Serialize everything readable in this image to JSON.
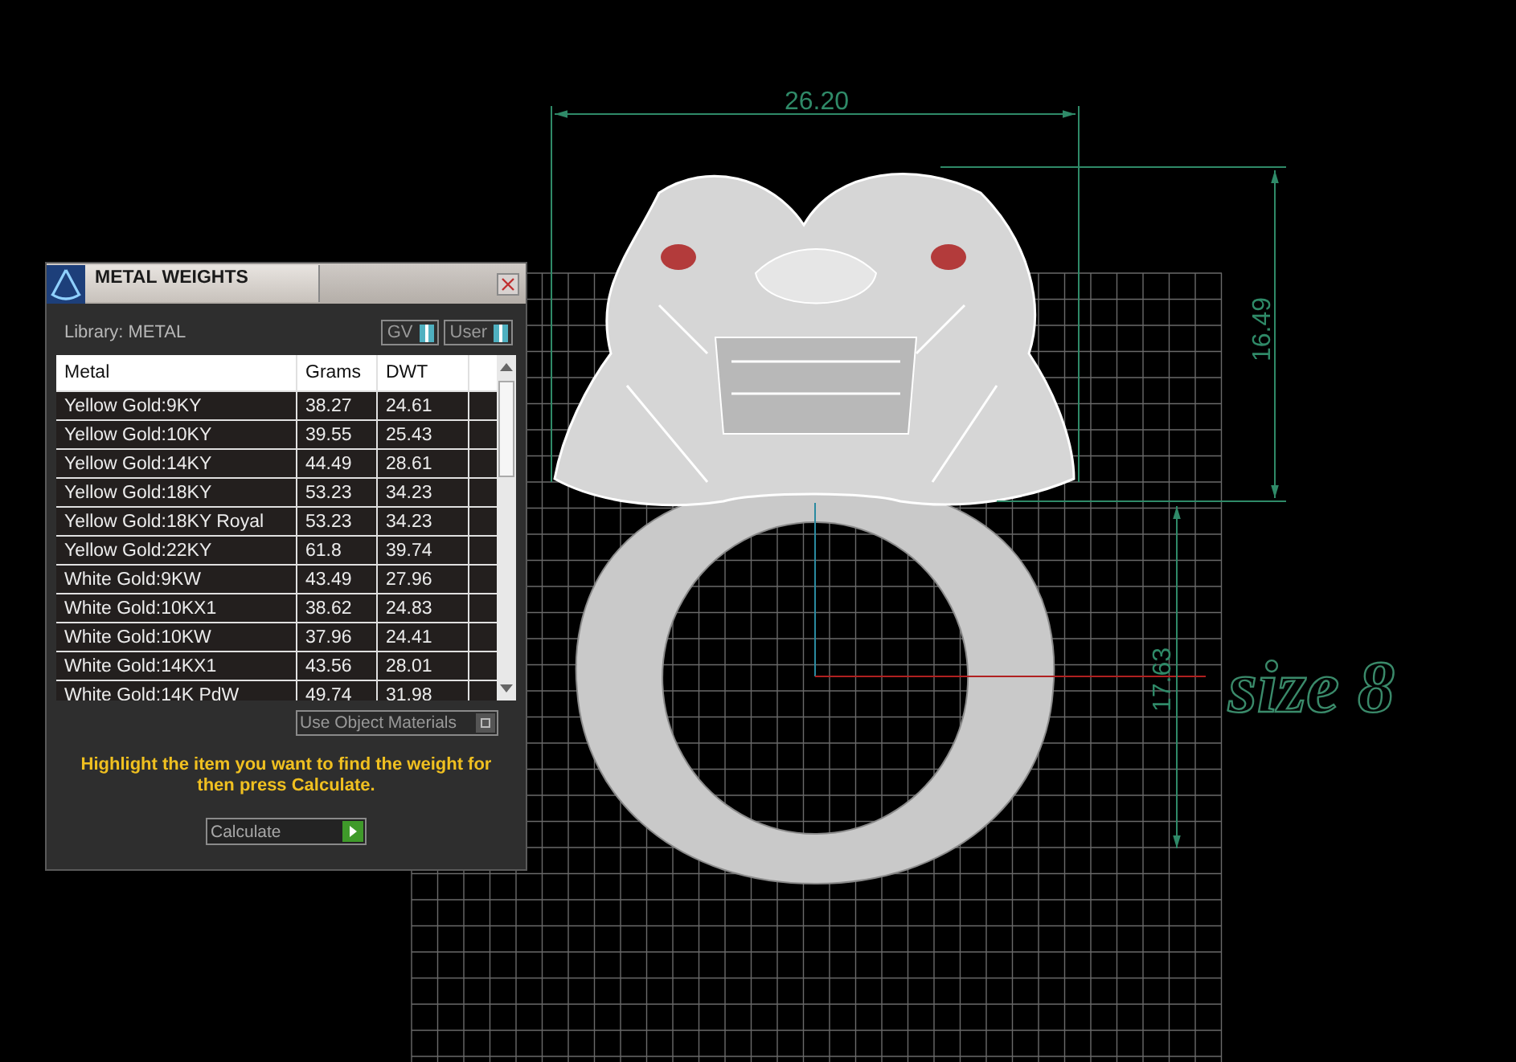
{
  "panel": {
    "title": "METAL WEIGHTS",
    "library": "Library: METAL",
    "toggles": [
      {
        "label": "GV",
        "on": true
      },
      {
        "label": "User",
        "on": true
      }
    ],
    "table": {
      "columns": [
        "Metal",
        "Grams",
        "DWT"
      ],
      "rows": [
        {
          "metal": "Yellow Gold:9KY",
          "grams": "38.27",
          "dwt": "24.61"
        },
        {
          "metal": "Yellow Gold:10KY",
          "grams": "39.55",
          "dwt": "25.43"
        },
        {
          "metal": "Yellow Gold:14KY",
          "grams": "44.49",
          "dwt": "28.61"
        },
        {
          "metal": "Yellow Gold:18KY",
          "grams": "53.23",
          "dwt": "34.23"
        },
        {
          "metal": "Yellow Gold:18KY Royal",
          "grams": "53.23",
          "dwt": "34.23"
        },
        {
          "metal": "Yellow Gold:22KY",
          "grams": "61.8",
          "dwt": "39.74"
        },
        {
          "metal": "White Gold:9KW",
          "grams": "43.49",
          "dwt": "27.96"
        },
        {
          "metal": "White Gold:10KX1",
          "grams": "38.62",
          "dwt": "24.83"
        },
        {
          "metal": "White Gold:10KW",
          "grams": "37.96",
          "dwt": "24.41"
        },
        {
          "metal": "White Gold:14KX1",
          "grams": "43.56",
          "dwt": "28.01"
        },
        {
          "metal": "White Gold:14K PdW",
          "grams": "49.74",
          "dwt": "31.98"
        }
      ]
    },
    "use_object_materials": {
      "label": "Use Object Materials",
      "on": false
    },
    "hint": "Highlight the item you want to find the weight for then press Calculate.",
    "calculate_button": "Calculate"
  },
  "viewport": {
    "width_dimension": "26.20",
    "height_dimension": "16.49",
    "inner_dimension": "17.63",
    "size_label": "size 8"
  }
}
